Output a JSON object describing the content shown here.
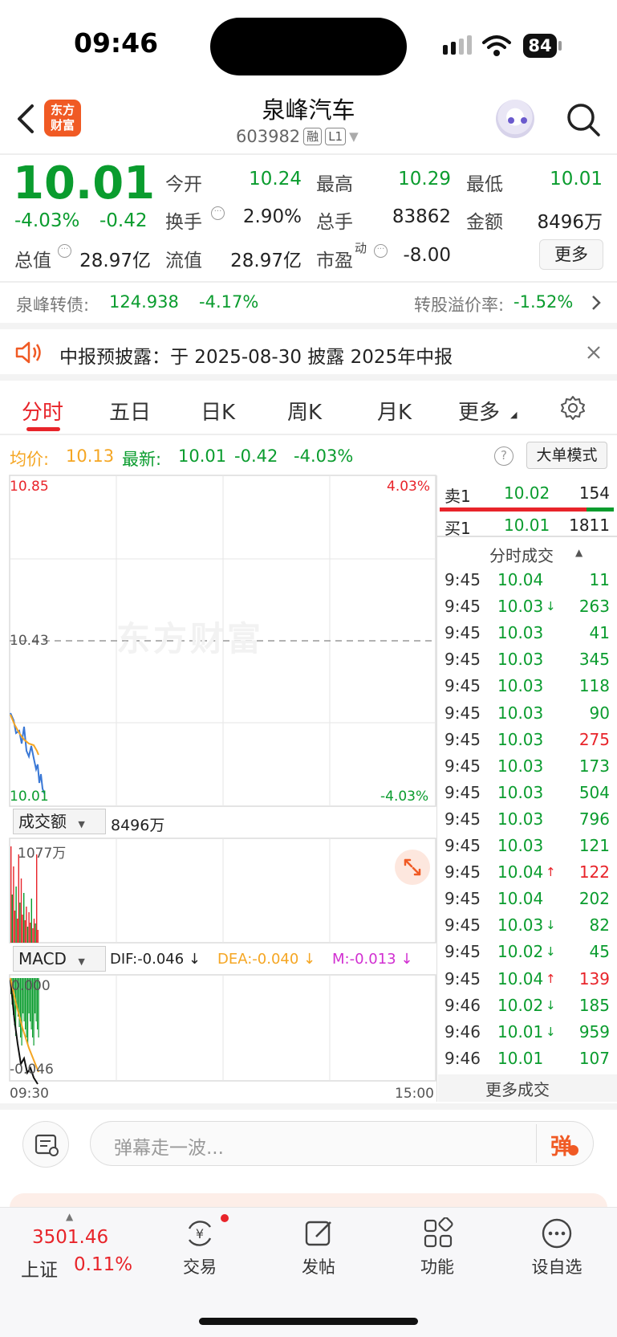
{
  "status": {
    "time": "09:46",
    "battery": "84"
  },
  "header": {
    "title": "泉峰汽车",
    "code": "603982",
    "tag1": "融",
    "tag2": "L1",
    "logo_line1": "东方",
    "logo_line2": "财富"
  },
  "quote": {
    "price": "10.01",
    "change_pct": "-4.03%",
    "change": "-0.42",
    "open_label": "今开",
    "open": "10.24",
    "high_label": "最高",
    "high": "10.29",
    "low_label": "最低",
    "low": "10.01",
    "turnover_label": "换手",
    "turnover": "2.90%",
    "volume_label": "总手",
    "volume": "83862",
    "amount_label": "金额",
    "amount": "8496万",
    "mktcap_label": "总值",
    "mktcap": "28.97亿",
    "float_label": "流值",
    "float": "28.97亿",
    "pe_label": "市盈",
    "pe_sup": "动",
    "pe": "-8.00",
    "more": "更多"
  },
  "bond": {
    "label": "泉峰转债:",
    "price": "124.938",
    "pct": "-4.17%",
    "premium_label": "转股溢价率:",
    "premium": "-1.52%"
  },
  "announcement": {
    "text": "中报预披露：于 2025-08-30 披露 2025年中报"
  },
  "tabs": [
    {
      "label": "分时"
    },
    {
      "label": "五日"
    },
    {
      "label": "日K"
    },
    {
      "label": "周K"
    },
    {
      "label": "月K"
    },
    {
      "label": "更多"
    }
  ],
  "avg": {
    "avg_label": "均价:",
    "avg": "10.13",
    "latest_label": "最新:",
    "latest": "10.01",
    "chg": "-0.42",
    "pct": "-4.03%",
    "bigorder": "大单模式"
  },
  "chart": {
    "watermark": "东方财富",
    "top_price": "10.85",
    "top_pct": "4.03%",
    "mid_price": "10.43",
    "bottom_price": "10.01",
    "bottom_pct": "-4.03%",
    "vol_select": "成交额",
    "vol_value": "8496万",
    "vol_max": "1077万",
    "macd_select": "MACD",
    "dif": "DIF:-0.046 ↓",
    "dea": "DEA:-0.040 ↓",
    "m": "M:-0.013 ↓",
    "macd_top": "0.000",
    "macd_bottom": "-0.046",
    "time_start": "09:30",
    "time_end": "15:00",
    "colors": {
      "price_line": "#3a78d6",
      "avg_line": "#f5a623",
      "up": "#e8242a",
      "down": "#0a9c2e"
    }
  },
  "orderbook": {
    "sell_label": "卖1",
    "sell_price": "10.02",
    "sell_vol": "154",
    "buy_label": "买1",
    "buy_price": "10.01",
    "buy_vol": "1811",
    "trades_title": "分时成交",
    "trades": [
      {
        "t": "9:45",
        "p": "10.04",
        "arrow": "",
        "v": "11",
        "vc": "green"
      },
      {
        "t": "9:45",
        "p": "10.03",
        "arrow": "↓",
        "v": "263",
        "vc": "green"
      },
      {
        "t": "9:45",
        "p": "10.03",
        "arrow": "",
        "v": "41",
        "vc": "green"
      },
      {
        "t": "9:45",
        "p": "10.03",
        "arrow": "",
        "v": "345",
        "vc": "green"
      },
      {
        "t": "9:45",
        "p": "10.03",
        "arrow": "",
        "v": "118",
        "vc": "green"
      },
      {
        "t": "9:45",
        "p": "10.03",
        "arrow": "",
        "v": "90",
        "vc": "green"
      },
      {
        "t": "9:45",
        "p": "10.03",
        "arrow": "",
        "v": "275",
        "vc": "red"
      },
      {
        "t": "9:45",
        "p": "10.03",
        "arrow": "",
        "v": "173",
        "vc": "green"
      },
      {
        "t": "9:45",
        "p": "10.03",
        "arrow": "",
        "v": "504",
        "vc": "green"
      },
      {
        "t": "9:45",
        "p": "10.03",
        "arrow": "",
        "v": "796",
        "vc": "green"
      },
      {
        "t": "9:45",
        "p": "10.03",
        "arrow": "",
        "v": "121",
        "vc": "green"
      },
      {
        "t": "9:45",
        "p": "10.04",
        "arrow": "↑",
        "v": "122",
        "vc": "red"
      },
      {
        "t": "9:45",
        "p": "10.04",
        "arrow": "",
        "v": "202",
        "vc": "green"
      },
      {
        "t": "9:45",
        "p": "10.03",
        "arrow": "↓",
        "v": "82",
        "vc": "green"
      },
      {
        "t": "9:45",
        "p": "10.02",
        "arrow": "↓",
        "v": "45",
        "vc": "green"
      },
      {
        "t": "9:45",
        "p": "10.04",
        "arrow": "↑",
        "v": "139",
        "vc": "red"
      },
      {
        "t": "9:46",
        "p": "10.02",
        "arrow": "↓",
        "v": "185",
        "vc": "green"
      },
      {
        "t": "9:46",
        "p": "10.01",
        "arrow": "↓",
        "v": "959",
        "vc": "green"
      },
      {
        "t": "9:46",
        "p": "10.01",
        "arrow": "",
        "v": "107",
        "vc": "green"
      }
    ],
    "more_trades": "更多成交"
  },
  "comment": {
    "placeholder": "弹幕走一波...",
    "danmu_btn": "弹"
  },
  "bottom_nav": {
    "index_value": "3501.46",
    "index_name": "上证",
    "index_pct": "0.11%",
    "items": [
      {
        "label": "交易"
      },
      {
        "label": "发帖"
      },
      {
        "label": "功能"
      },
      {
        "label": "设自选"
      }
    ]
  }
}
